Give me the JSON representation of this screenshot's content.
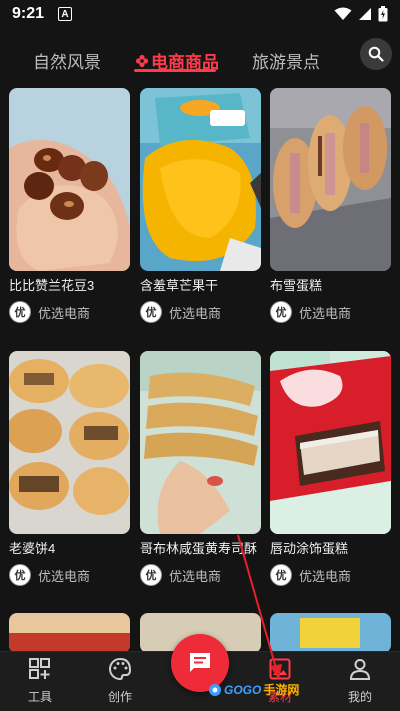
{
  "status": {
    "time": "9:21",
    "notification_glyph": "A"
  },
  "tabs": [
    {
      "label": "自然风景"
    },
    {
      "label": "电商商品"
    },
    {
      "label": "旅游景点"
    }
  ],
  "cards": [
    {
      "title": "比比赞兰花豆3",
      "shop": "优选电商",
      "avatar": "优",
      "image": "fava-beans-photo"
    },
    {
      "title": "含羞草芒果干",
      "shop": "优选电商",
      "avatar": "优",
      "image": "dried-mango-photo"
    },
    {
      "title": "布雪蛋糕",
      "shop": "优选电商",
      "avatar": "优",
      "image": "sandwich-cake-photo"
    },
    {
      "title": "老婆饼4",
      "shop": "优选电商",
      "avatar": "优",
      "image": "wife-cake-photo"
    },
    {
      "title": "哥布林咸蛋黄寿司酥",
      "shop": "优选电商",
      "avatar": "优",
      "image": "egg-yolk-biscuit-photo"
    },
    {
      "title": "唇动涂饰蛋糕",
      "shop": "优选电商",
      "avatar": "优",
      "image": "coated-cake-photo"
    }
  ],
  "nav": {
    "tools": "工具",
    "create": "创作",
    "materials": "素材",
    "mine": "我的"
  },
  "watermark": {
    "part1": "GOGO",
    "part2": "手游网"
  },
  "colors": {
    "accent": "#ff3b4a",
    "background": "#141414",
    "nav_bg": "#1d1d1d"
  }
}
